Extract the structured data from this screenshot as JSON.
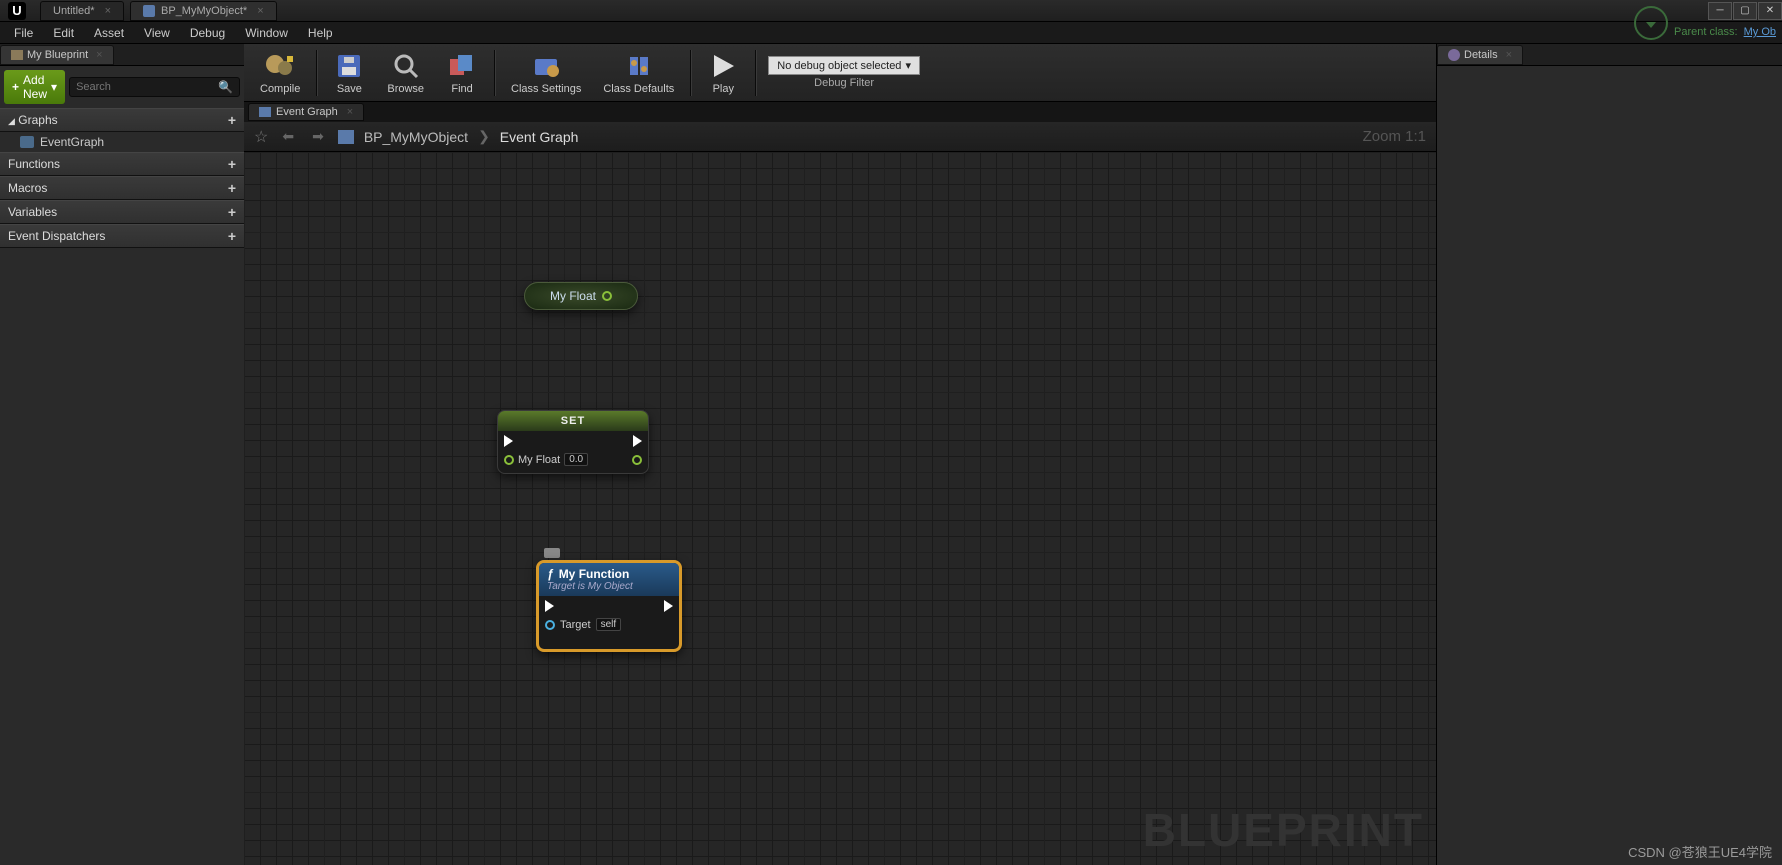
{
  "title_tabs": [
    {
      "label": "Untitled*"
    },
    {
      "label": "BP_MyMyObject*"
    }
  ],
  "menus": [
    "File",
    "Edit",
    "Asset",
    "View",
    "Debug",
    "Window",
    "Help"
  ],
  "parent_class": {
    "prefix": "Parent class:",
    "link": "My Ob"
  },
  "my_blueprint": {
    "title": "My Blueprint",
    "add_button": "Add New",
    "search_placeholder": "Search",
    "sections": {
      "graphs": {
        "label": "Graphs",
        "items": [
          "EventGraph"
        ]
      },
      "functions": {
        "label": "Functions"
      },
      "macros": {
        "label": "Macros"
      },
      "variables": {
        "label": "Variables"
      },
      "dispatchers": {
        "label": "Event Dispatchers"
      }
    }
  },
  "toolbar": {
    "compile": "Compile",
    "save": "Save",
    "browse": "Browse",
    "find": "Find",
    "class_settings": "Class Settings",
    "class_defaults": "Class Defaults",
    "play": "Play",
    "debug_combo": "No debug object selected",
    "debug_filter": "Debug Filter"
  },
  "graph_tab": {
    "label": "Event Graph"
  },
  "breadcrumb": {
    "root": "BP_MyMyObject",
    "leaf": "Event Graph",
    "zoom": "Zoom 1:1"
  },
  "nodes": {
    "get": {
      "label": "My Float"
    },
    "set": {
      "title": "SET",
      "pin_label": "My Float",
      "value": "0.0"
    },
    "func": {
      "title": "My Function",
      "subtitle": "Target is My Object",
      "target_label": "Target",
      "target_value": "self"
    }
  },
  "watermark": "BLUEPRINT",
  "details": {
    "title": "Details"
  },
  "footer": "CSDN @苍狼王UE4学院"
}
